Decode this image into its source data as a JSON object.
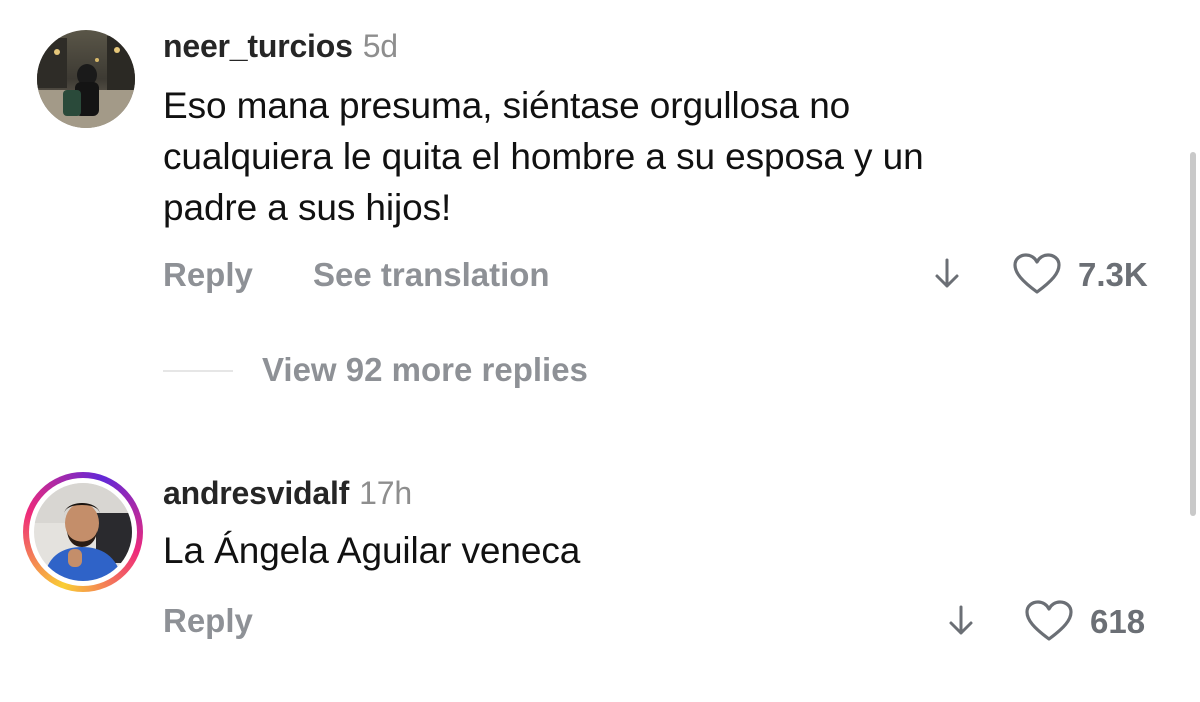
{
  "comments": [
    {
      "username": "neer_turcios",
      "time": "5d",
      "text_lines": [
        "Eso mana presuma, siéntase orgullosa no",
        "cualquiera le quita el hombre a su esposa y un",
        "padre a sus hijos!"
      ],
      "reply_label": "Reply",
      "translate_label": "See translation",
      "likes": "7.3K",
      "view_replies": "View 92 more replies",
      "avatar_icon": "avatar-photo-street"
    },
    {
      "username": "andresvidalf",
      "time": "17h",
      "text_lines": [
        "La Ángela Aguilar veneca"
      ],
      "reply_label": "Reply",
      "likes": "618",
      "avatar_icon": "avatar-photo-story-ring"
    }
  ],
  "icons": {
    "down": "arrow-down-icon",
    "like": "heart-icon"
  },
  "colors": {
    "story_ring_start": "#f9ce34",
    "story_ring_mid": "#ee2a7b",
    "story_ring_end": "#6228d7",
    "muted": "#8e9196"
  }
}
